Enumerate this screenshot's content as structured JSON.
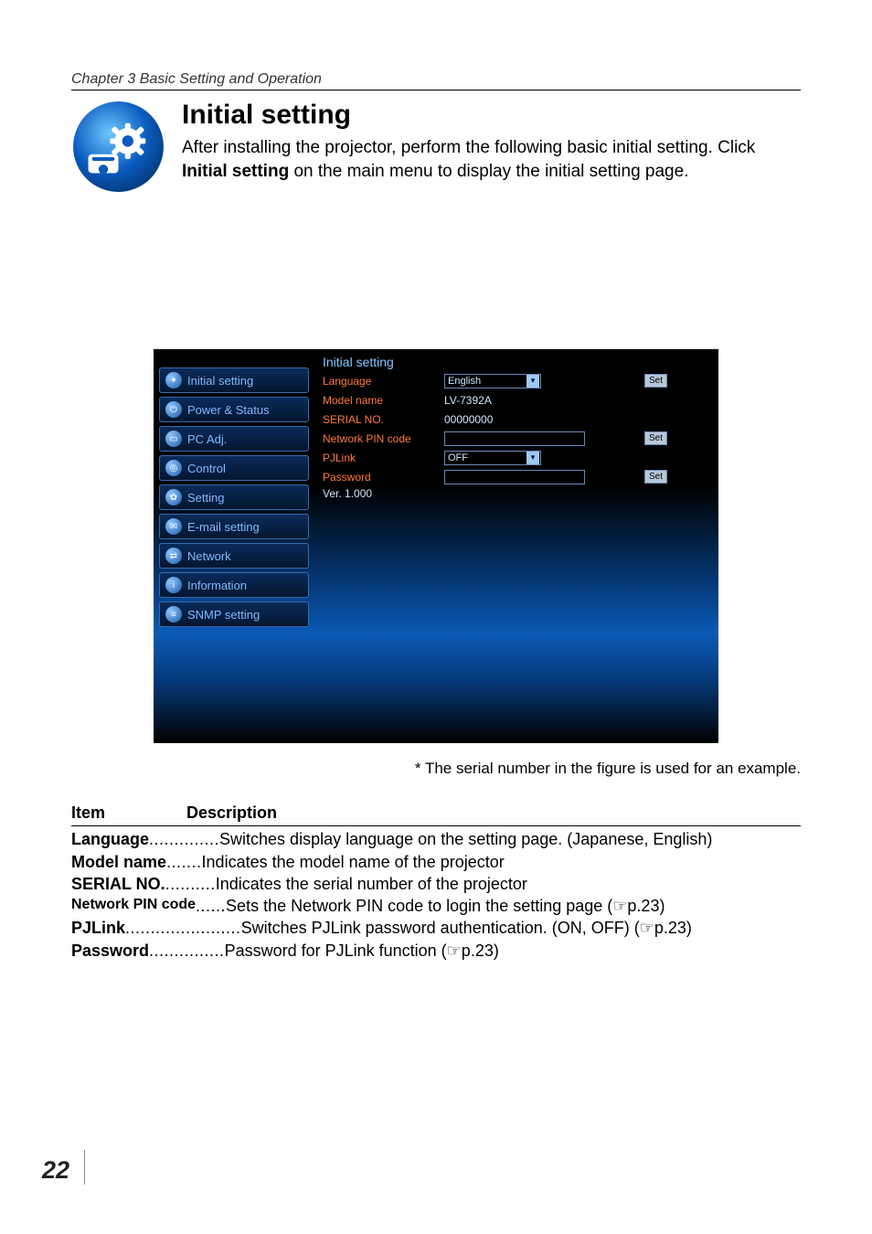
{
  "chapter_header": "Chapter 3 Basic Setting and Operation",
  "title": "Initial setting",
  "intro_before": "After installing the projector, perform the following basic initial setting. Click ",
  "intro_bold": "Initial setting",
  "intro_after": " on the main menu to display the initial setting page.",
  "screenshot": {
    "nav": [
      "Initial setting",
      "Power & Status",
      "PC Adj.",
      "Control",
      "Setting",
      "E-mail setting",
      "Network",
      "Information",
      "SNMP setting"
    ],
    "panel_title": "Initial setting",
    "rows": {
      "language": {
        "label": "Language",
        "value": "English",
        "button": "Set"
      },
      "model_name": {
        "label": "Model name",
        "value": "LV-7392A"
      },
      "serial_no": {
        "label": "SERIAL NO.",
        "value": "00000000"
      },
      "pin_code": {
        "label": "Network PIN code",
        "value": "",
        "button": "Set"
      },
      "pjlink": {
        "label": "PJLink",
        "value": "OFF"
      },
      "password": {
        "label": "Password",
        "value": "",
        "button": "Set"
      },
      "version": "Ver. 1.000"
    }
  },
  "caption": "* The serial number in the figure is used for an example.",
  "table": {
    "h_item": "Item",
    "h_desc": "Description",
    "rows": [
      {
        "term": "Language",
        "dots": "..............",
        "desc": "Switches display language on the setting page. (Japanese, English)"
      },
      {
        "term": "Model name",
        "dots": " .......",
        "desc": "Indicates the model name of the projector"
      },
      {
        "term": "SERIAL NO.",
        "dots": "  ..........",
        "desc": "Indicates the serial number of the projector"
      },
      {
        "term": "Network PIN code",
        "dots": " ......",
        "desc": "Sets the Network PIN code to login the setting page (☞p.23)",
        "small_term": true
      },
      {
        "term": "PJLink",
        "dots": ".......................",
        "desc": "Switches PJLink password authentication. (ON, OFF) (☞p.23)"
      },
      {
        "term": "Password",
        "dots": "...............",
        "desc": "Password for PJLink function (☞p.23)"
      }
    ]
  },
  "page_number": "22"
}
